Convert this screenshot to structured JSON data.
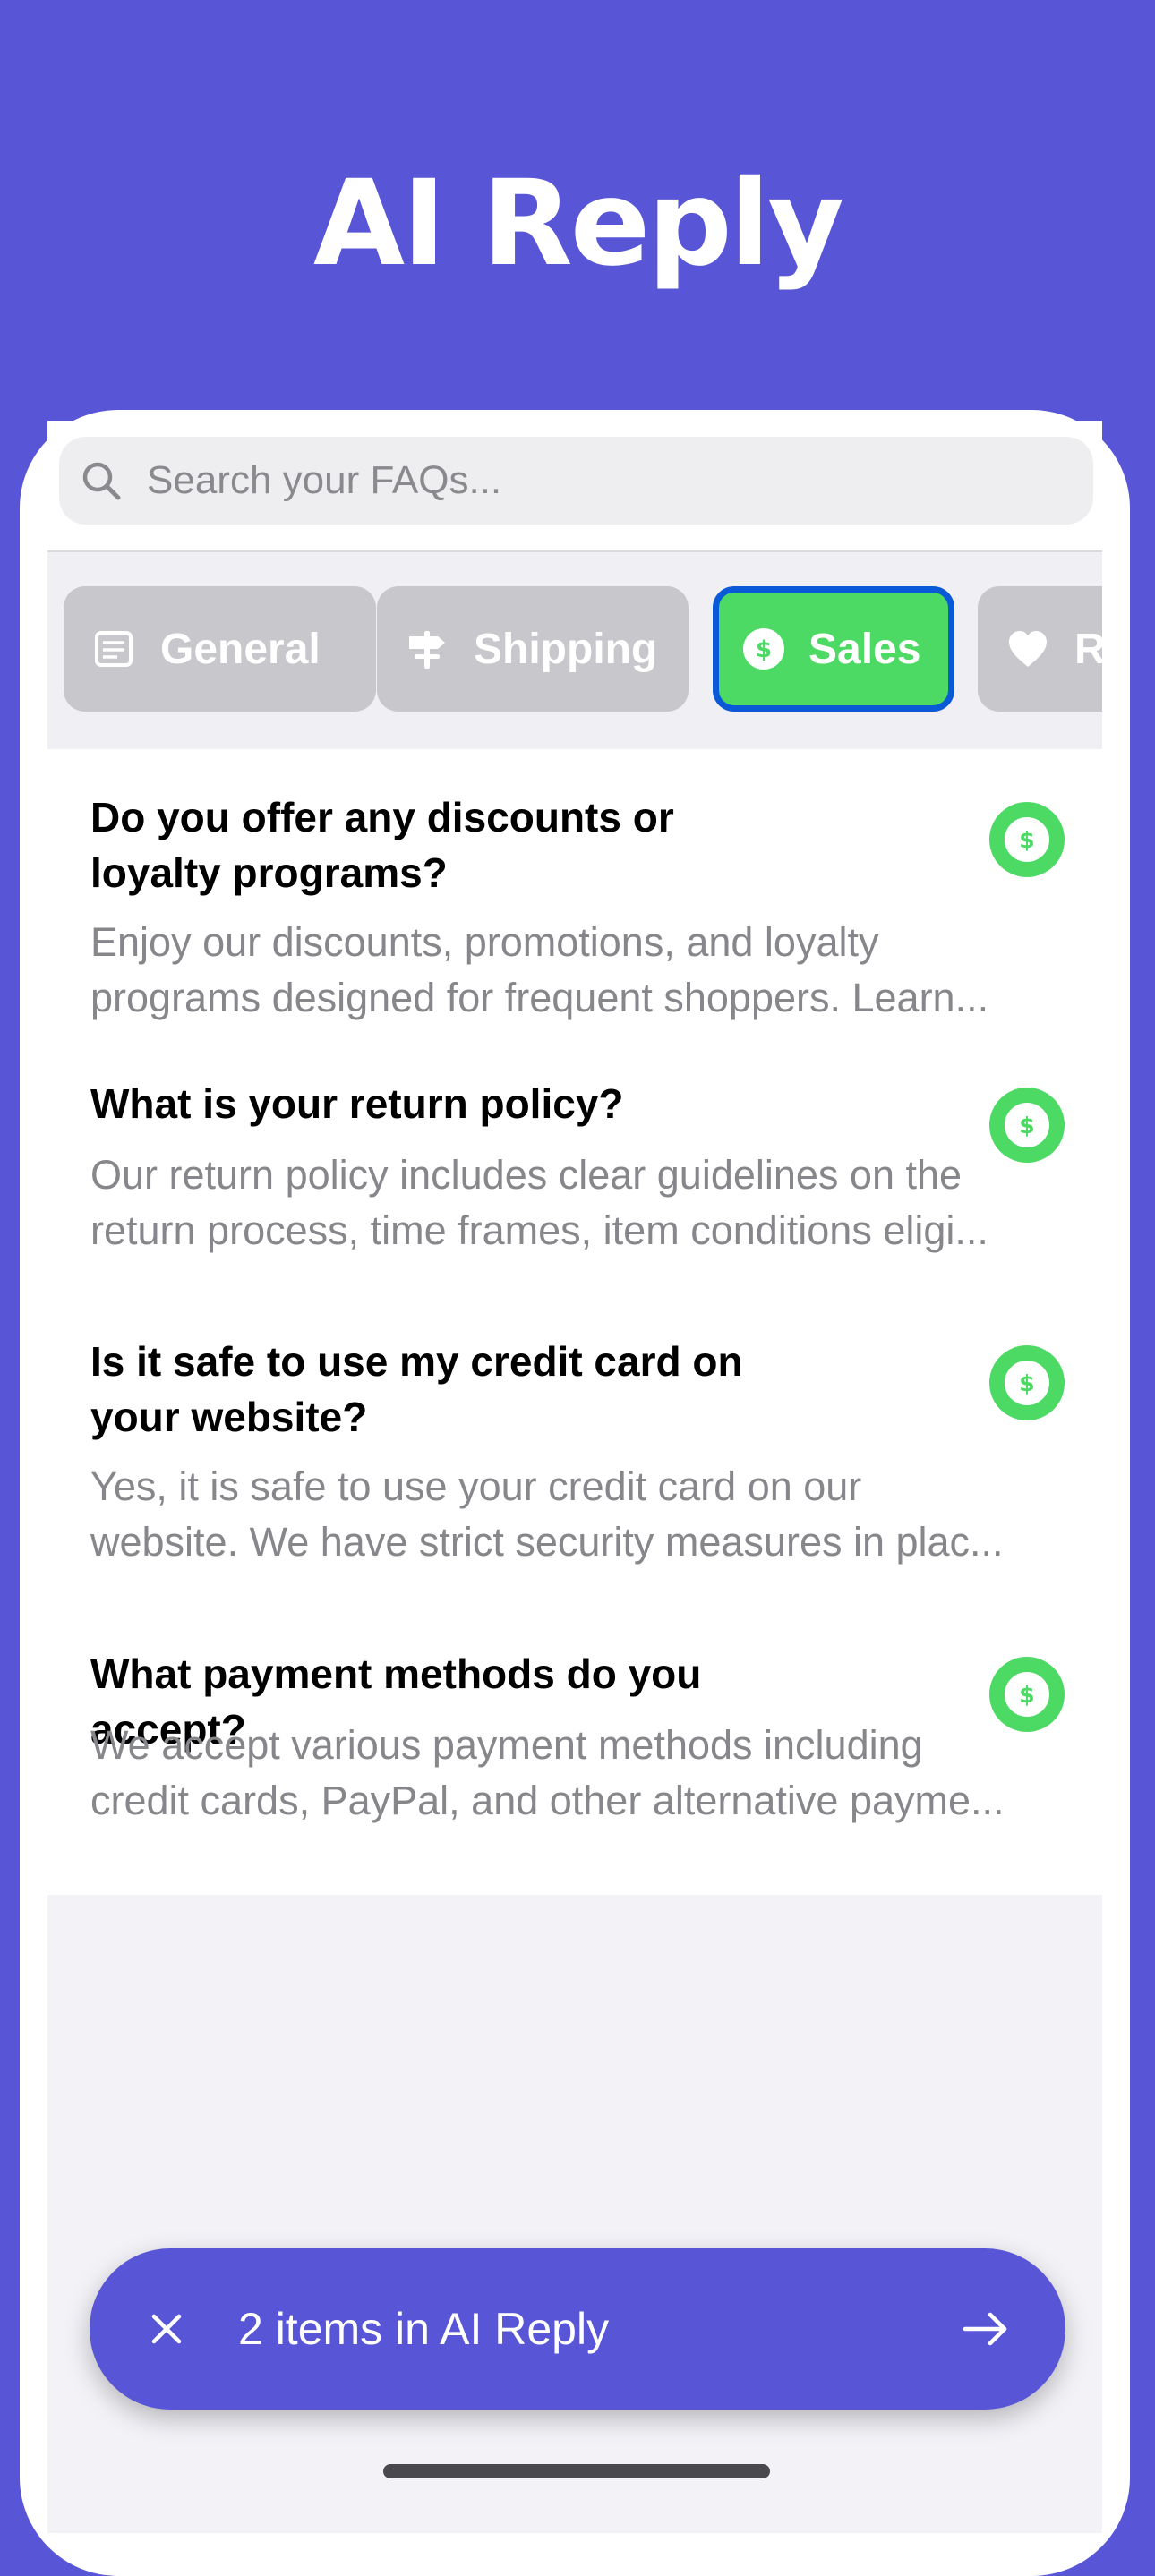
{
  "hero": {
    "title": "AI Reply"
  },
  "search": {
    "placeholder": "Search your FAQs..."
  },
  "categories": [
    {
      "label": "General",
      "icon": "document-icon",
      "selected": false
    },
    {
      "label": "Shipping",
      "icon": "signpost-icon",
      "selected": false
    },
    {
      "label": "Sales",
      "icon": "dollar-circle-icon",
      "selected": true
    },
    {
      "label": "Re",
      "icon": "heart-icon",
      "selected": false
    }
  ],
  "faqs": [
    {
      "question_lines": [
        "Do you offer any discounts or",
        "loyalty programs?"
      ],
      "answer_lines": [
        "Enjoy our discounts, promotions, and loyalty",
        "programs designed for frequent shoppers. Learn..."
      ],
      "badge_icon": "dollar-circle-icon"
    },
    {
      "question_lines": [
        "What is your return policy?"
      ],
      "answer_lines": [
        "Our return policy includes clear guidelines on the",
        "return process, time frames, item conditions eligi..."
      ],
      "badge_icon": "dollar-circle-icon"
    },
    {
      "question_lines": [
        "Is it safe to use my credit card on",
        "your website?"
      ],
      "answer_lines": [
        "Yes, it is safe to use your credit card on our",
        "website. We have strict security measures in plac..."
      ],
      "badge_icon": "dollar-circle-icon"
    },
    {
      "question_lines": [
        "What payment methods do you accept?"
      ],
      "answer_lines": [
        "We accept various payment methods including",
        "credit cards, PayPal, and other alternative payme..."
      ],
      "badge_icon": "dollar-circle-icon"
    }
  ],
  "action_bar": {
    "label": "2 items in AI Reply",
    "close_icon": "close-icon",
    "arrow_icon": "arrow-right-icon"
  },
  "colors": {
    "brand": "#5856D6",
    "sales_green": "#4CD964",
    "selected_border": "#0A5AD8",
    "chip_inactive": "#C7C7CC"
  }
}
